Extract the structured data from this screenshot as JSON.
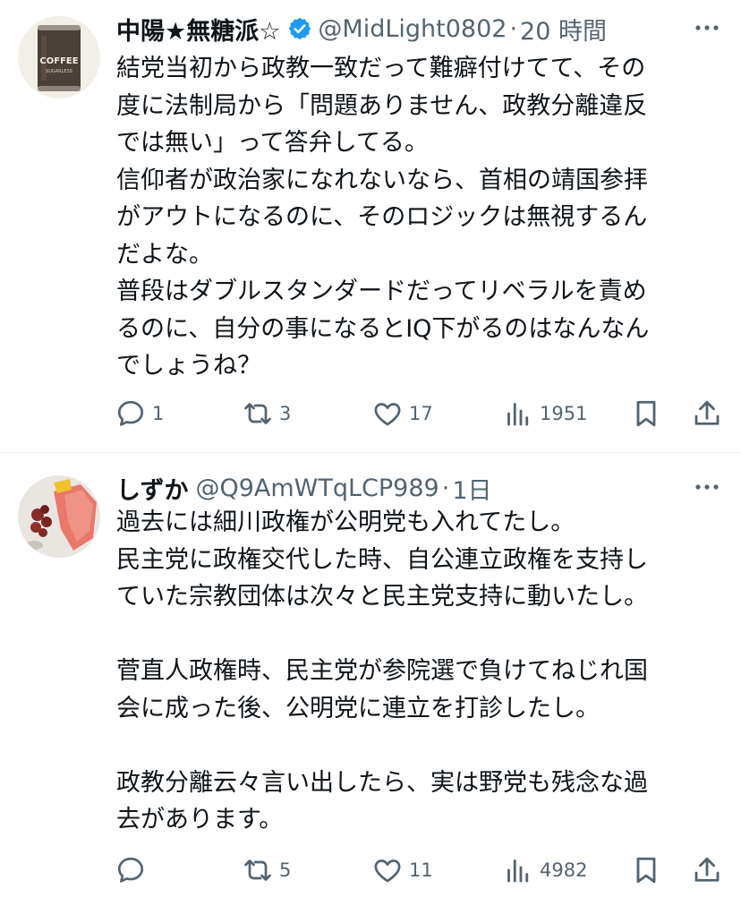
{
  "colors": {
    "text_primary": "#0f1419",
    "text_secondary": "#536471",
    "verified_blue": "#1d9bf0",
    "divider": "#eff3f4"
  },
  "posts": [
    {
      "display_name": "中陽★無糖派☆",
      "verified": true,
      "verified_icon": "verified-badge-icon",
      "handle": "@MidLight0802",
      "separator": "·",
      "time": "20 時間",
      "avatar_icon": "coffee-can-avatar",
      "avatar_text_top": "COFFEE",
      "avatar_text_bottom": "SUGARLESS",
      "body": "結党当初から政教一致だって難癖付けてて、その\n度に法制局から「問題ありません、政教分離違反\nでは無い」って答弁してる。\n信仰者が政治家になれないなら、首相の靖国参拝\nがアウトになるのに、そのロジックは無視するん\nだよな。\n普段はダブルスタンダードだってリベラルを責め\nるのに、自分の事になるとIQ下がるのはなんなん\nでしょうね？",
      "actions": {
        "reply_count": "1",
        "retweet_count": "3",
        "like_count": "17",
        "views_count": "1951"
      }
    },
    {
      "display_name": "しずか",
      "verified": false,
      "handle": "@Q9AmWTqLCP989",
      "separator": "·",
      "time": "1日",
      "avatar_icon": "food-photo-avatar",
      "body": "過去には細川政権が公明党も入れてたし。\n民主党に政権交代した時、自公連立政権を支持し\nていた宗教団体は次々と民主党支持に動いたし。\n\n菅直人政権時、民主党が参院選で負けてねじれ国\n会に成った後、公明党に連立を打診したし。\n\n政教分離云々言い出したら、実は野党も残念な過\n去があります。",
      "actions": {
        "reply_count": "",
        "retweet_count": "5",
        "like_count": "11",
        "views_count": "4982"
      }
    }
  ],
  "icons": {
    "more": "more-horizontal-icon",
    "reply": "reply-icon",
    "retweet": "retweet-icon",
    "like": "like-heart-icon",
    "views": "views-bar-chart-icon",
    "bookmark": "bookmark-icon",
    "share": "share-icon"
  }
}
